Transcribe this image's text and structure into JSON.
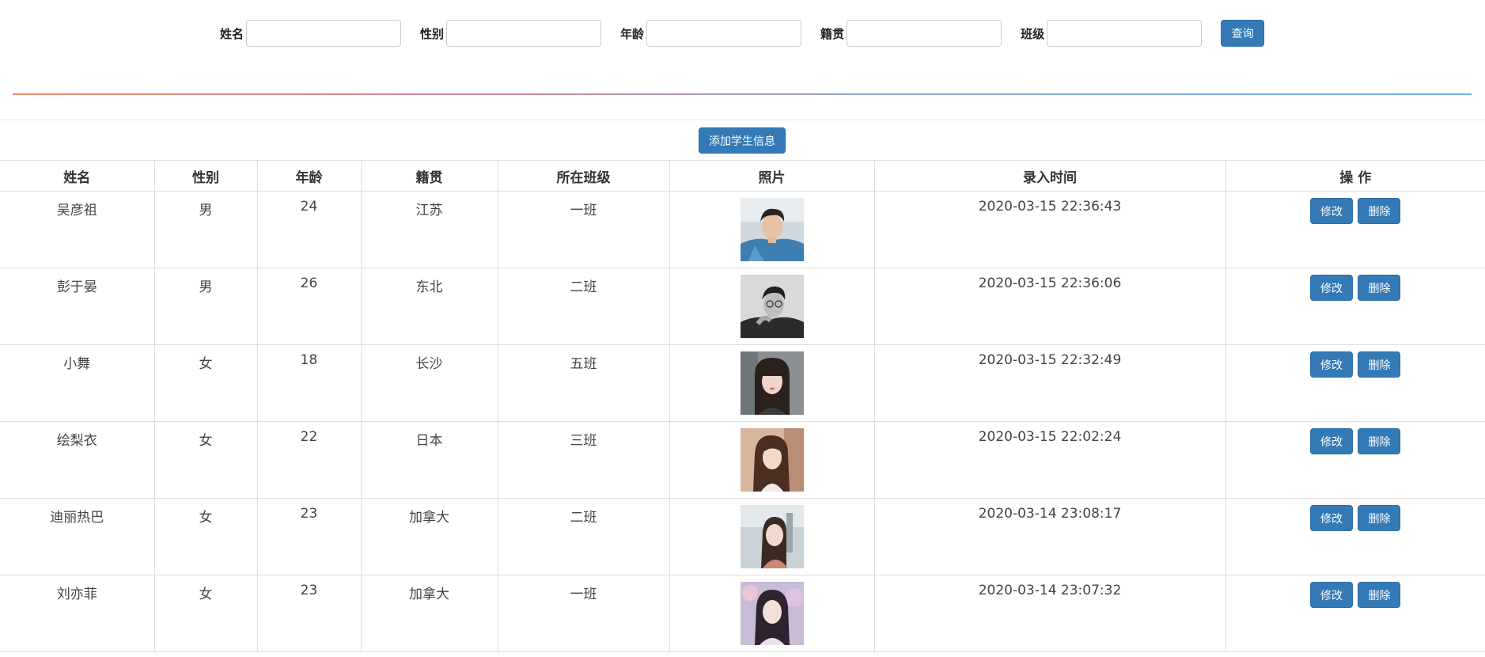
{
  "search": {
    "fields": [
      {
        "label": "姓名",
        "value": "",
        "placeholder": ""
      },
      {
        "label": "性别",
        "value": "",
        "placeholder": ""
      },
      {
        "label": "年龄",
        "value": "",
        "placeholder": ""
      },
      {
        "label": "籍贯",
        "value": "",
        "placeholder": ""
      },
      {
        "label": "班级",
        "value": "",
        "placeholder": ""
      }
    ],
    "query_label": "查询"
  },
  "add_button_label": "添加学生信息",
  "table": {
    "headers": [
      "姓名",
      "性别",
      "年龄",
      "籍贯",
      "所在班级",
      "照片",
      "录入时间",
      "操 作"
    ],
    "rows": [
      {
        "name": "吴彦祖",
        "gender": "男",
        "age": "24",
        "origin": "江苏",
        "class": "一班",
        "photo": "photo-man-denim",
        "time": "2020-03-15 22:36:43"
      },
      {
        "name": "彭于晏",
        "gender": "男",
        "age": "26",
        "origin": "东北",
        "class": "二班",
        "photo": "photo-man-bw",
        "time": "2020-03-15 22:36:06"
      },
      {
        "name": "小舞",
        "gender": "女",
        "age": "18",
        "origin": "长沙",
        "class": "五班",
        "photo": "photo-woman-bangs",
        "time": "2020-03-15 22:32:49"
      },
      {
        "name": "绘梨衣",
        "gender": "女",
        "age": "22",
        "origin": "日本",
        "class": "三班",
        "photo": "photo-woman-warm",
        "time": "2020-03-15 22:02:24"
      },
      {
        "name": "迪丽热巴",
        "gender": "女",
        "age": "23",
        "origin": "加拿大",
        "class": "二班",
        "photo": "photo-woman-street",
        "time": "2020-03-14 23:08:17"
      },
      {
        "name": "刘亦菲",
        "gender": "女",
        "age": "23",
        "origin": "加拿大",
        "class": "一班",
        "photo": "photo-woman-blossom",
        "time": "2020-03-14 23:07:32"
      }
    ],
    "edit_label": "修改",
    "delete_label": "删除"
  },
  "colors": {
    "primary": "#337ab7",
    "primary_border": "#2e6da4",
    "table_border": "#dddddd"
  }
}
